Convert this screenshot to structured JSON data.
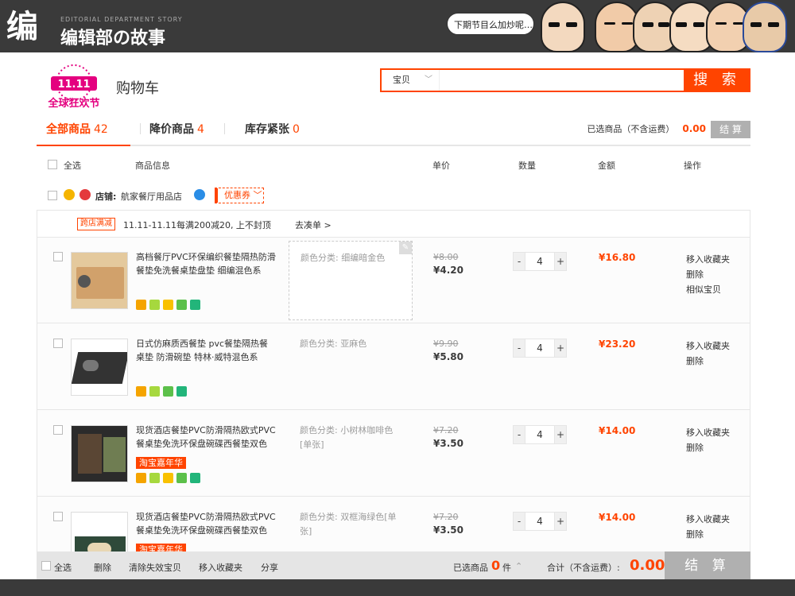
{
  "banner": {
    "logo_char": "编",
    "subtitle": "EDITORIAL DEPARTMENT STORY",
    "title": "编辑部の故事",
    "bubble": "下期节目么加炒呢…"
  },
  "header": {
    "brand_logo_text": "11.11",
    "brand_logo_sub": "全球狂欢节",
    "cart_title": "购物车"
  },
  "search": {
    "category": "宝贝",
    "button": "搜 索",
    "placeholder": ""
  },
  "tabs": [
    {
      "label": "全部商品",
      "count": "42"
    },
    {
      "label": "降价商品",
      "count": "4"
    },
    {
      "label": "库存紧张",
      "count": "0"
    }
  ],
  "summary": {
    "label": "已选商品（不含运费）",
    "amount": "0.00",
    "button": "结 算"
  },
  "columns": {
    "select_all": "全选",
    "info": "商品信息",
    "unit_price": "单价",
    "quantity": "数量",
    "amount": "金额",
    "action": "操作"
  },
  "shop": {
    "label": "店铺:",
    "name": "航家餐厅用品店",
    "coupon": "优惠券"
  },
  "promo": {
    "tag": "跨店满减",
    "text": "11.11-11.11每满200减20, 上不封顶",
    "link": "去凑单 >"
  },
  "items": [
    {
      "name": "高档餐厅PVC环保编织餐垫隔热防滑餐垫免洗餐桌垫盘垫 细编混色系",
      "spec_label": "颜色分类:",
      "spec_value": "细编暗金色",
      "old_price": "¥8.00",
      "price": "¥4.20",
      "qty": "4",
      "sum": "¥16.80",
      "ops": [
        "移入收藏夹",
        "删除",
        "相似宝贝"
      ]
    },
    {
      "name": "日式仿麻质西餐垫 pvc餐垫隔热餐桌垫 防滑碗垫 特林·威特混色系",
      "spec_label": "颜色分类:",
      "spec_value": "亚麻色",
      "old_price": "¥9.90",
      "price": "¥5.80",
      "qty": "4",
      "sum": "¥23.20",
      "ops": [
        "移入收藏夹",
        "删除"
      ]
    },
    {
      "name": "现货酒店餐垫PVC防滑隔热欧式PVC餐桌垫免洗环保盘碗碟西餐垫双色",
      "spec_label": "颜色分类:",
      "spec_value": "小树林咖啡色[单张]",
      "old_price": "¥7.20",
      "price": "¥3.50",
      "qty": "4",
      "sum": "¥14.00",
      "carnival": "淘宝嘉年华",
      "ops": [
        "移入收藏夹",
        "删除"
      ]
    },
    {
      "name": "现货酒店餐垫PVC防滑隔热欧式PVC餐桌垫免洗环保盘碗碟西餐垫双色",
      "spec_label": "颜色分类:",
      "spec_value": "双框海绿色[单张]",
      "old_price": "¥7.20",
      "price": "¥3.50",
      "qty": "4",
      "sum": "¥14.00",
      "carnival": "淘宝嘉年华",
      "ops": [
        "移入收藏夹",
        "删除"
      ]
    }
  ],
  "bottom": {
    "select_all": "全选",
    "delete": "删除",
    "clear_invalid": "清除失效宝贝",
    "move_fav": "移入收藏夹",
    "share": "分享",
    "selected_label": "已选商品",
    "selected_count": "0",
    "unit": "件",
    "arrow": "⌃",
    "total_label": "合计（不含运费）:",
    "total": "0.00",
    "checkout": "结 算"
  },
  "colors": {
    "accent": "#ff4400",
    "banner": "#3a3a3a",
    "disabled": "#b0b0b0"
  },
  "icons": [
    "search-icon",
    "chevron-down-icon",
    "edit-icon",
    "shop-icon"
  ]
}
